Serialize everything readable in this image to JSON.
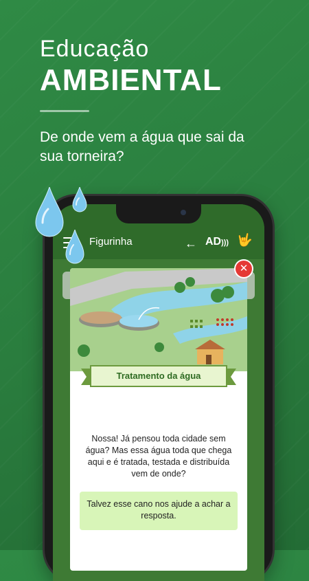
{
  "promo": {
    "headline_line1": "Educação",
    "headline_line2": "AMBIENTAL",
    "subtitle": "De onde vem a água que sai da sua torneira?"
  },
  "app_bar": {
    "title": "Figurinha",
    "back_icon": "arrow-left-icon",
    "audio_description_label": "AD",
    "sign_language_icon": "sign-language-icon",
    "menu_icon": "hamburger-menu-icon"
  },
  "modal": {
    "ribbon_title": "Tratamento da água",
    "body": "Nossa! Já pensou toda cidade sem água? Mas essa água toda que chega aqui e é tratada, testada e distribuída vem de onde?",
    "hint": "Talvez esse cano nos ajude a achar a resposta.",
    "close_icon": "close-icon"
  },
  "colors": {
    "background": "#2a7d3e",
    "app_bar": "#2f6b2a",
    "hint_box": "#d8f5b8",
    "close_button": "#e53935",
    "ribbon_text": "#2e6b22"
  }
}
